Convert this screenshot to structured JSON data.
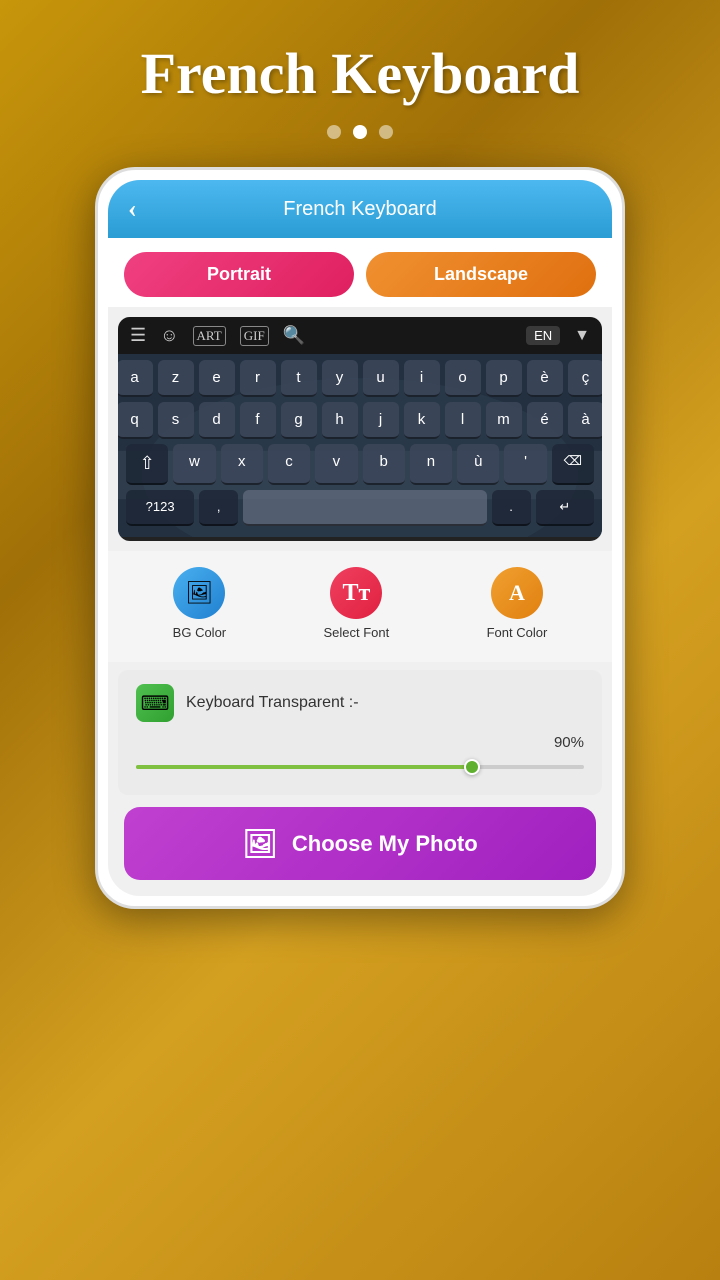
{
  "page": {
    "title": "French Keyboard",
    "bg_color": "#a07008"
  },
  "dots": {
    "count": 3,
    "active_index": 1
  },
  "header": {
    "title": "French Keyboard",
    "back_label": "‹"
  },
  "tabs": {
    "portrait_label": "Portrait",
    "landscape_label": "Landscape"
  },
  "keyboard": {
    "lang": "EN",
    "row1": [
      "a",
      "z",
      "e",
      "r",
      "t",
      "y",
      "u",
      "i",
      "o",
      "p",
      "è",
      "ç"
    ],
    "row2": [
      "q",
      "s",
      "d",
      "f",
      "g",
      "h",
      "j",
      "k",
      "l",
      "m",
      "é",
      "à"
    ],
    "row3": [
      "w",
      "x",
      "c",
      "v",
      "b",
      "n",
      "ù",
      "'"
    ],
    "bottom": [
      "?123",
      ",",
      "",
      ".",
      "↵"
    ]
  },
  "controls": {
    "bg_color_label": "BG Color",
    "select_font_label": "Select Font",
    "font_color_label": "Font Color"
  },
  "transparent": {
    "label": "Keyboard Transparent :-",
    "percent": "90%",
    "slider_fill_percent": 75
  },
  "choose_photo": {
    "label": "Choose My Photo"
  }
}
